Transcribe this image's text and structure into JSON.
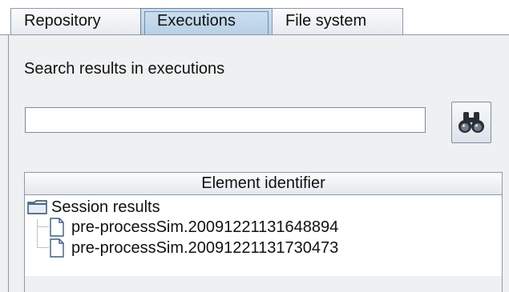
{
  "tabs": [
    {
      "label": "Repository",
      "selected": false
    },
    {
      "label": "Executions",
      "selected": true
    },
    {
      "label": "File system",
      "selected": false
    }
  ],
  "search": {
    "label": "Search results in executions",
    "value": "",
    "button_icon": "binoculars-icon"
  },
  "table": {
    "column_header": "Element identifier",
    "root": {
      "label": "Session results",
      "icon": "folder-icon"
    },
    "items": [
      {
        "label": "pre-processSim.20091221131648894",
        "icon": "file-icon"
      },
      {
        "label": "pre-processSim.20091221131730473",
        "icon": "file-icon"
      }
    ]
  },
  "colors": {
    "selected_tab": "#b8d0e6",
    "panel_background": "#eef0f1",
    "border": "#8d9aaa"
  }
}
